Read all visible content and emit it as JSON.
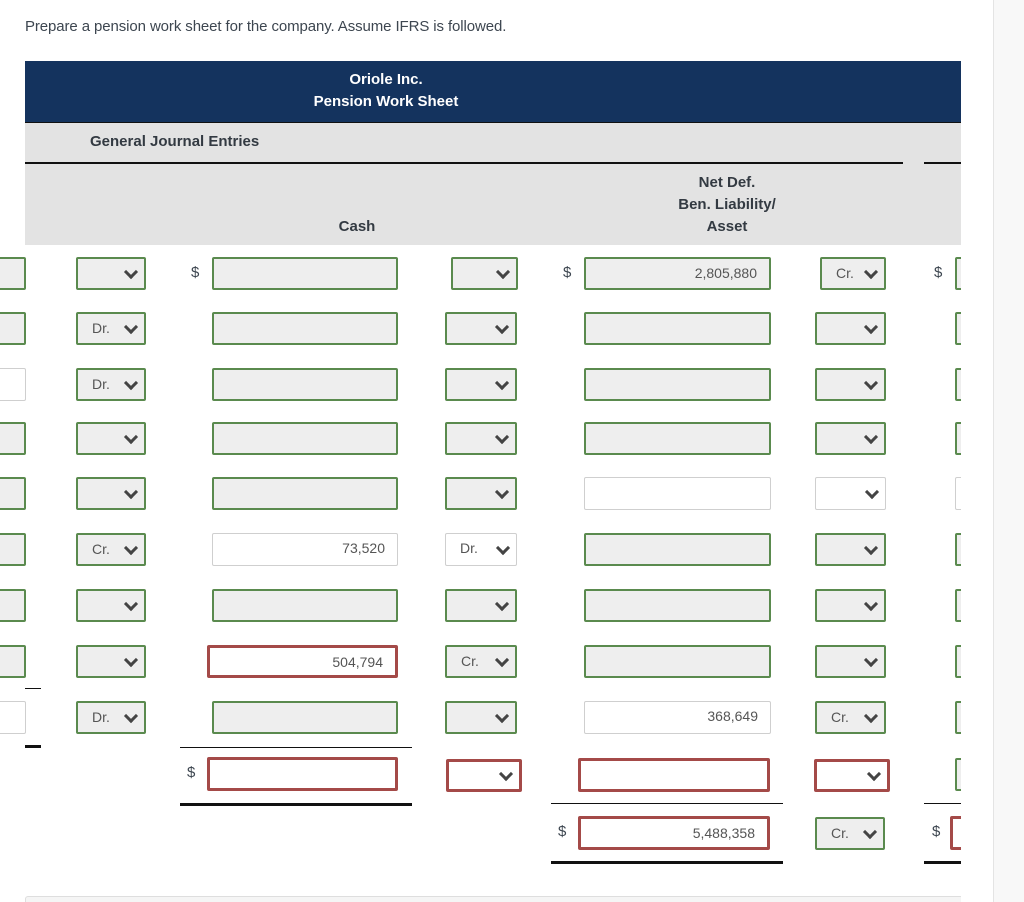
{
  "instruction": "Prepare a pension work sheet for the company. Assume IFRS is followed.",
  "worksheet": {
    "company": "Oriole Inc.",
    "title": "Pension Work Sheet",
    "section_label": "General Journal Entries",
    "columns": [
      {
        "key": "cash",
        "header_lines": [
          "",
          "",
          "Cash"
        ]
      },
      {
        "key": "ndbl",
        "header_lines": [
          "Net Def.",
          "Ben. Liability/",
          "Asset"
        ]
      }
    ],
    "currency_symbol": "$",
    "rows": [
      {
        "left_clip_state": "normal",
        "a_sel": "",
        "a_sel_state": "normal",
        "cash": "",
        "cash_state": "normal",
        "b_sel": "",
        "b_sel_state": "normal",
        "ndbl": "2,805,880",
        "ndbl_state": "normal",
        "c_sel": "Cr.",
        "c_sel_state": "normal",
        "right_clip_state": "normal",
        "dollar": true
      },
      {
        "left_clip_state": "normal",
        "a_sel": "Dr.",
        "a_sel_state": "normal",
        "cash": "",
        "cash_state": "normal",
        "b_sel": "",
        "b_sel_state": "normal",
        "ndbl": "",
        "ndbl_state": "normal",
        "c_sel": "",
        "c_sel_state": "normal",
        "right_clip_state": "normal",
        "dollar": false
      },
      {
        "left_clip_state": "given",
        "a_sel": "Dr.",
        "a_sel_state": "normal",
        "cash": "",
        "cash_state": "normal",
        "b_sel": "",
        "b_sel_state": "normal",
        "ndbl": "",
        "ndbl_state": "normal",
        "c_sel": "",
        "c_sel_state": "normal",
        "right_clip_state": "normal",
        "dollar": false
      },
      {
        "left_clip_state": "normal",
        "a_sel": "",
        "a_sel_state": "normal",
        "cash": "",
        "cash_state": "normal",
        "b_sel": "",
        "b_sel_state": "normal",
        "ndbl": "",
        "ndbl_state": "normal",
        "c_sel": "",
        "c_sel_state": "normal",
        "right_clip_state": "normal",
        "dollar": false
      },
      {
        "left_clip_state": "normal",
        "a_sel": "",
        "a_sel_state": "normal",
        "cash": "",
        "cash_state": "normal",
        "b_sel": "",
        "b_sel_state": "normal",
        "ndbl": "",
        "ndbl_state": "given",
        "c_sel": "",
        "c_sel_state": "given",
        "right_clip_state": "given",
        "dollar": false
      },
      {
        "left_clip_state": "normal",
        "a_sel": "Cr.",
        "a_sel_state": "normal",
        "cash": "73,520",
        "cash_state": "given",
        "b_sel": "Dr.",
        "b_sel_state": "given",
        "ndbl": "",
        "ndbl_state": "normal",
        "c_sel": "",
        "c_sel_state": "normal",
        "right_clip_state": "normal",
        "dollar": false
      },
      {
        "left_clip_state": "normal",
        "a_sel": "",
        "a_sel_state": "normal",
        "cash": "",
        "cash_state": "normal",
        "b_sel": "",
        "b_sel_state": "normal",
        "ndbl": "",
        "ndbl_state": "normal",
        "c_sel": "",
        "c_sel_state": "normal",
        "right_clip_state": "normal",
        "dollar": false
      },
      {
        "left_clip_state": "normal",
        "a_sel": "",
        "a_sel_state": "normal",
        "cash": "504,794",
        "cash_state": "error",
        "b_sel": "Cr.",
        "b_sel_state": "normal",
        "ndbl": "",
        "ndbl_state": "normal",
        "c_sel": "",
        "c_sel_state": "normal",
        "right_clip_state": "normal",
        "dollar": false
      },
      {
        "left_clip_state": "given",
        "a_sel": "Dr.",
        "a_sel_state": "normal",
        "cash": "",
        "cash_state": "normal",
        "b_sel": "",
        "b_sel_state": "normal",
        "ndbl": "368,649",
        "ndbl_state": "given",
        "c_sel": "Cr.",
        "c_sel_state": "normal",
        "right_clip_state": "normal",
        "dollar": false
      }
    ],
    "totals": {
      "cash_total": {
        "value": "",
        "state": "error",
        "dollar": true
      },
      "cash_total_sel": {
        "value": "",
        "state": "error"
      },
      "ndbl_subtotal": {
        "value": "",
        "state": "error"
      },
      "ndbl_subtotal_sel": {
        "value": "",
        "state": "error"
      },
      "right_subtotal_state": "normal",
      "ndbl_total": {
        "value": "5,488,358",
        "state": "error",
        "dollar": true
      },
      "ndbl_total_sel": {
        "value": "Cr.",
        "state": "normal"
      },
      "right_total_state": "error"
    }
  },
  "colors": {
    "header_navy": "#14335e",
    "section_gray": "#e3e3e3",
    "input_border_ok": "#5a8a4e",
    "input_border_error": "#a44a48",
    "input_fill": "#eeeeee"
  }
}
